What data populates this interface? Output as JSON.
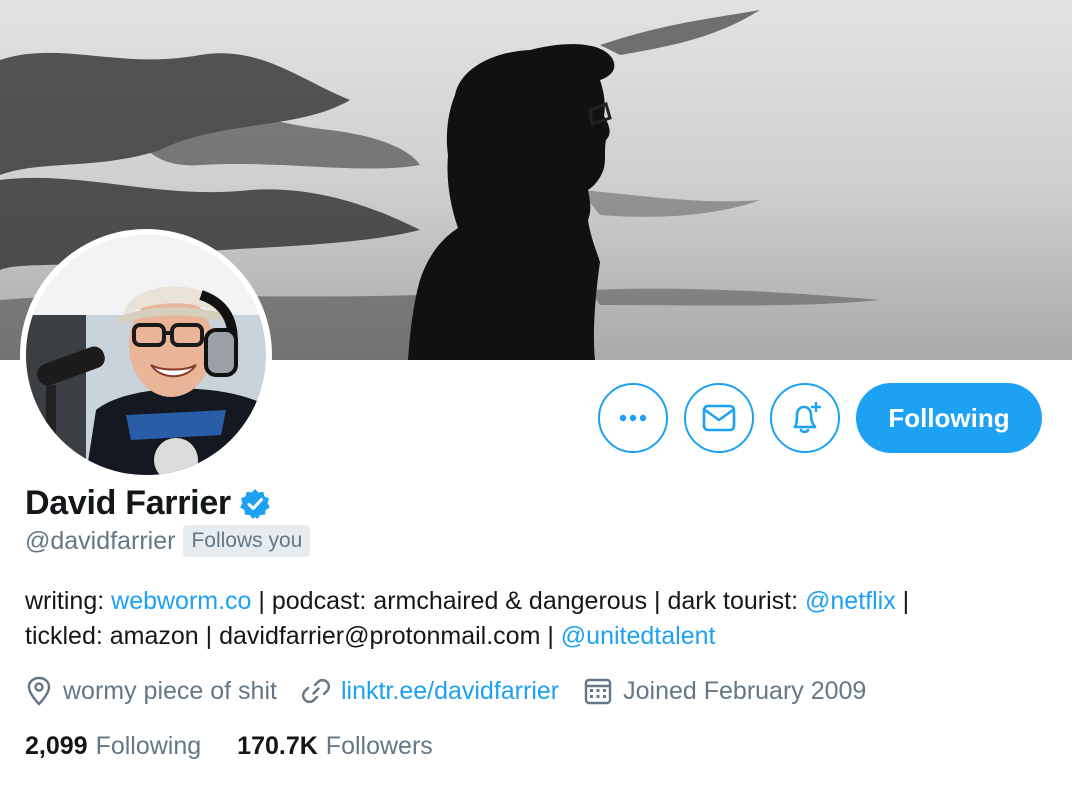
{
  "profile": {
    "name": "David Farrier",
    "handle": "@davidfarrier",
    "follows_you_label": "Follows you",
    "verified": true,
    "bio": {
      "writing_prefix": "writing: ",
      "writing_link": "webworm.co",
      "podcast_text": " | podcast: armchaired & dangerous | dark tourist: ",
      "netflix_link": "@netflix",
      "sep1": " |",
      "line2_text": "tickled: amazon | davidfarrier@protonmail.com | ",
      "agency_link": "@unitedtalent"
    },
    "location": "wormy piece of shit",
    "website": "linktr.ee/davidfarrier",
    "joined": "Joined February 2009",
    "following_count": "2,099",
    "following_label": "Following",
    "followers_count": "170.7K",
    "followers_label": "Followers"
  },
  "actions": {
    "more_icon": "more-dots-icon",
    "message_icon": "envelope-icon",
    "notify_icon": "bell-plus-icon",
    "following_button": "Following"
  },
  "colors": {
    "accent": "#1da1f2",
    "secondary_text": "#657786",
    "primary_text": "#14171a",
    "badge_bg": "#e6ecf0"
  }
}
